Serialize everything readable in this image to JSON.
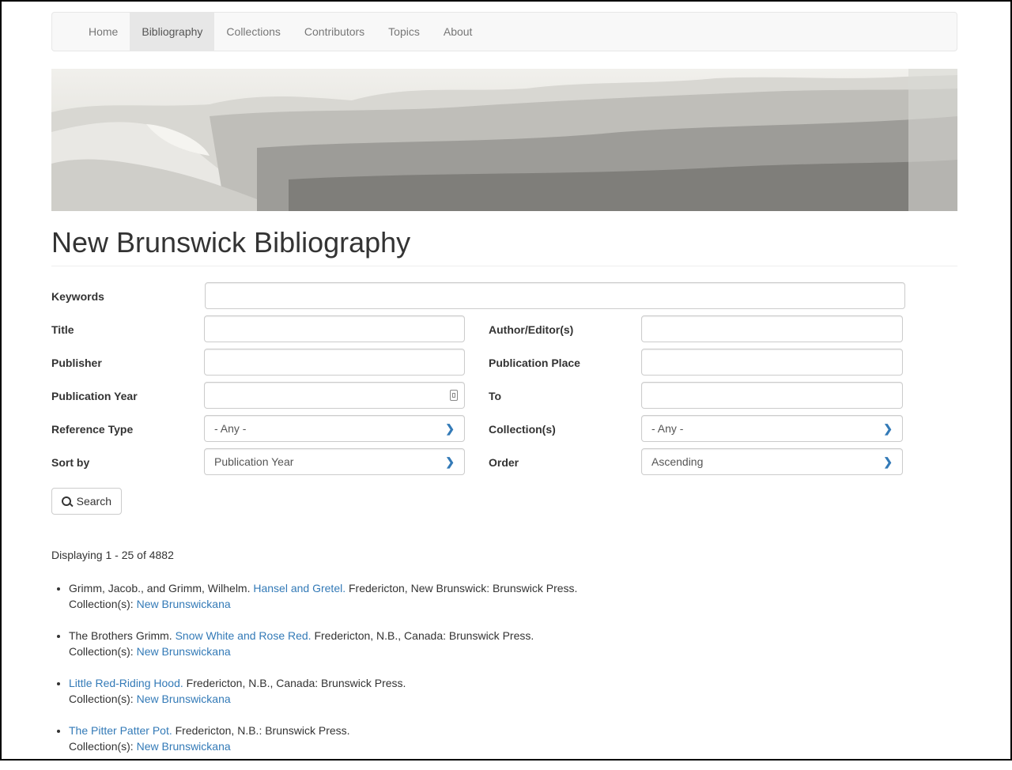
{
  "nav": {
    "items": [
      {
        "label": "Home"
      },
      {
        "label": "Bibliography"
      },
      {
        "label": "Collections"
      },
      {
        "label": "Contributors"
      },
      {
        "label": "Topics"
      },
      {
        "label": "About"
      }
    ]
  },
  "page": {
    "title": "New Brunswick Bibliography"
  },
  "form": {
    "keywords_label": "Keywords",
    "title_label": "Title",
    "author_label": "Author/Editor(s)",
    "publisher_label": "Publisher",
    "pub_place_label": "Publication Place",
    "pub_year_label": "Publication Year",
    "to_label": "To",
    "ref_type_label": "Reference Type",
    "ref_type_value": "- Any -",
    "collections_label": "Collection(s)",
    "collections_value": "- Any -",
    "sort_label": "Sort by",
    "sort_value": "Publication Year",
    "order_label": "Order",
    "order_value": "Ascending",
    "search_label": "Search"
  },
  "results": {
    "count_text": "Displaying 1 - 25 of 4882",
    "collection_prefix": "Collection(s):",
    "items": [
      {
        "author": "Grimm, Jacob., and Grimm, Wilhelm.",
        "title": "Hansel and Gretel.",
        "pub": "Fredericton, New Brunswick: Brunswick Press.",
        "collection": "New Brunswickana"
      },
      {
        "author": "The Brothers Grimm.",
        "title": "Snow White and Rose Red.",
        "pub": "Fredericton, N.B., Canada: Brunswick Press.",
        "collection": "New Brunswickana"
      },
      {
        "author": "",
        "title": "Little Red-Riding Hood.",
        "pub": "Fredericton, N.B., Canada: Brunswick Press.",
        "collection": "New Brunswickana"
      },
      {
        "author": "",
        "title": "The Pitter Patter Pot.",
        "pub": "Fredericton, N.B.: Brunswick Press.",
        "collection": "New Brunswickana"
      }
    ]
  },
  "colors": {
    "link": "#337ab7",
    "nav_bg": "#f8f8f8",
    "nav_active": "#e7e7e7"
  },
  "icons": {
    "search": "magnifier-icon",
    "select": "chevron-down-icon",
    "date": "calendar-icon"
  }
}
